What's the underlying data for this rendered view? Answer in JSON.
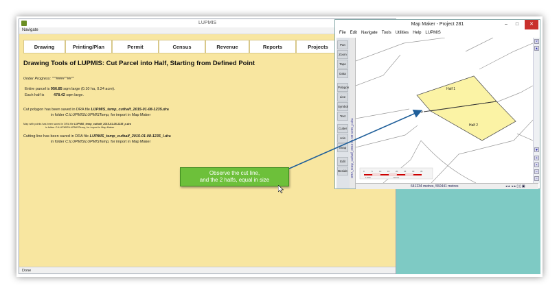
{
  "lupmis": {
    "title": "LUPMIS",
    "menu": "Navigate",
    "nav": [
      "Drawing",
      "Printing/Plan",
      "Permit",
      "Census",
      "Revenue",
      "Reports",
      "Projects"
    ],
    "heading": "Drawing Tools of LUPMIS: Cut Parcel into Half, Starting from Defined Point",
    "progress": "Under Progress: \"\"\"####\"\"##\"\"",
    "entire_prefix": "Entire parcel is",
    "entire_value": "956.85",
    "entire_suffix": "sqm large (0.10 ha, 0.24 acre).",
    "half_prefix": "Each half is",
    "half_value": "478.42",
    "half_suffix": "sqm large.",
    "cut_saved_prefix": "Cut polygon has been saved in DRA file",
    "cut_saved_file": "LUPMIS_temp_cuthalf_2015-01-08-1235.dra",
    "cut_saved_folder_prefix": "in folder",
    "cut_saved_folder": "C:\\LUPMIS\\LUPMISTemp,",
    "cut_saved_folder_suffix": "for import in Map Maker",
    "points_saved_prefix": "Map with points has been saved in DRA file",
    "points_saved_file": "LUPMIS_temp_cuthalf_2015-01-08-1235_p.dra",
    "points_saved_folder": "in folder C:\\LUPMIS\\LUPMISTemp, for import in Map Maker",
    "line_saved_prefix": "Cutting line has been saved in DRA file",
    "line_saved_file": "LUPMIS_temp_cuthalf_2015-01-08-1235_l.dra",
    "line_saved_folder_prefix": "in folder",
    "line_saved_folder": "C:\\LUPMIS\\LUPMISTemp,",
    "line_saved_folder_suffix": "for import in Map Maker",
    "status": "Done"
  },
  "mapmaker": {
    "title": "Map Maker - Project 281",
    "menu": [
      "File",
      "Edit",
      "Navigate",
      "Tools",
      "Utilities",
      "Help",
      "LUPMIS"
    ],
    "tools": [
      "Pan",
      "Zoom",
      "Tape",
      "Data",
      "Polygon",
      "Line",
      "Symbol",
      "Text",
      "Cutter",
      "Join",
      "Snap",
      "Edit",
      "Beside"
    ],
    "vstrip_label": "DRA_temp_cuthalf_2015-01-08-1235_p.dra",
    "half1_label": "Half 1",
    "half2_label": "Half 2",
    "scale_ticks": [
      "0",
      "5",
      "10",
      "15",
      "20",
      "25",
      "30",
      "35"
    ],
    "scale_ratio": "1:359",
    "scale_unit": "metres",
    "coords": "641234 metres, 550441 metres",
    "window_min": "–",
    "window_max": "□",
    "window_close": "✕"
  },
  "callout": {
    "line1": "Observe the cut line,",
    "line2": "and the 2 halfs, equal in size"
  },
  "colors": {
    "lupmis_bg": "#f8e6a0",
    "parcel_fill": "#fbf3a5",
    "callout_bg": "#6dc03a",
    "arrow": "#1f5f9a",
    "teal": "#7ecac4"
  }
}
